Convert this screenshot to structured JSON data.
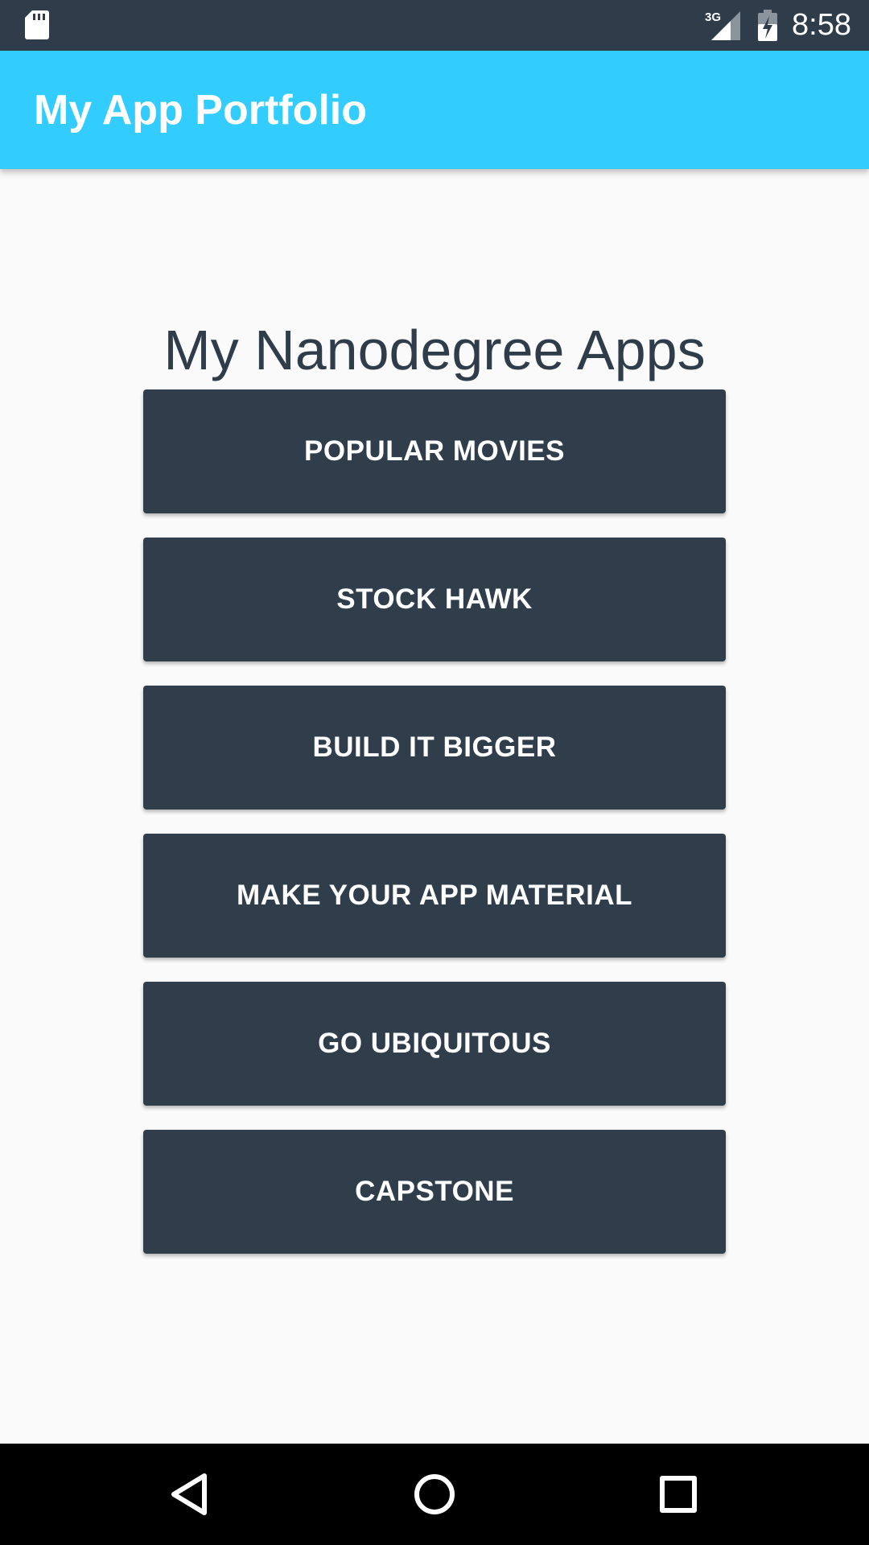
{
  "status_bar": {
    "time": "8:58",
    "network_label": "3G",
    "icons": [
      "sd-card-icon",
      "cell-signal-icon",
      "battery-charging-icon"
    ]
  },
  "app_bar": {
    "title": "My App Portfolio",
    "color": "#33ccff"
  },
  "main": {
    "heading": "My Nanodegree Apps",
    "buttons": [
      {
        "label": "POPULAR MOVIES"
      },
      {
        "label": "STOCK HAWK"
      },
      {
        "label": "BUILD IT BIGGER"
      },
      {
        "label": "MAKE YOUR APP MATERIAL"
      },
      {
        "label": "GO UBIQUITOUS"
      },
      {
        "label": "CAPSTONE"
      }
    ],
    "button_color": "#303d4b"
  },
  "nav_bar": {
    "icons": [
      "back-icon",
      "home-icon",
      "recents-icon"
    ]
  }
}
